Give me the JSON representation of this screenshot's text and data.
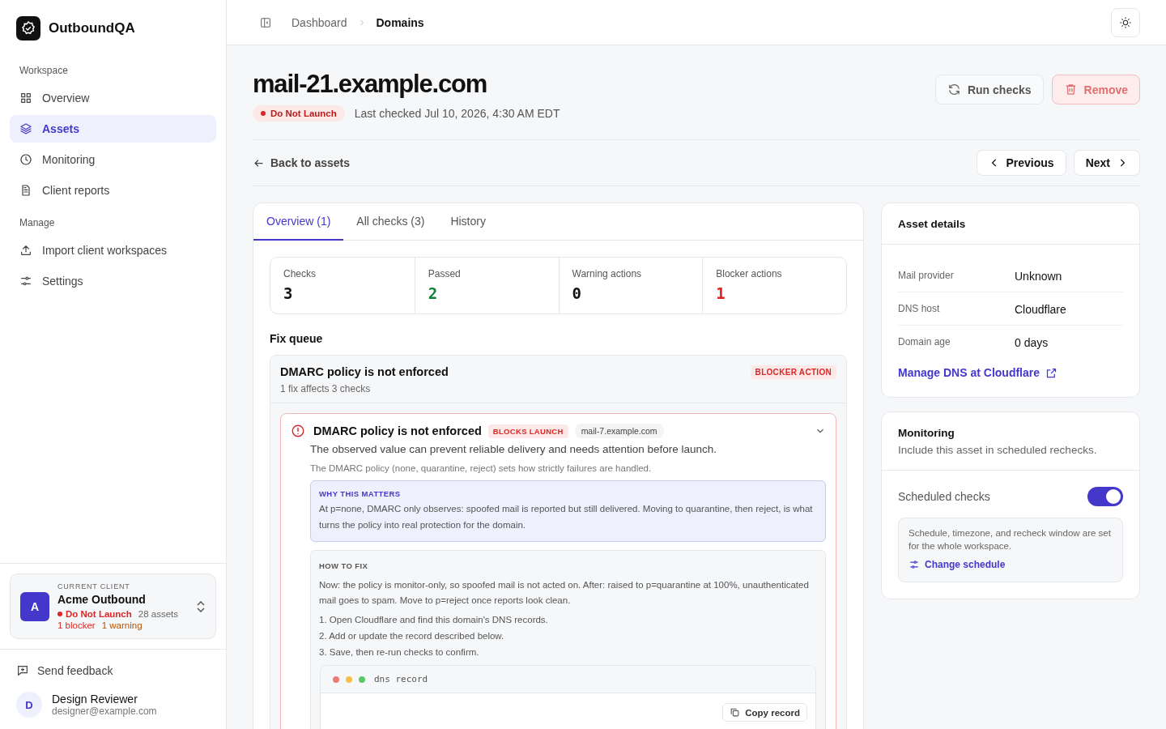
{
  "app": {
    "name": "OutboundQA"
  },
  "sidebar": {
    "sections": [
      {
        "title": "Workspace",
        "items": [
          {
            "label": "Overview",
            "selected": false
          },
          {
            "label": "Assets",
            "selected": true
          },
          {
            "label": "Monitoring",
            "selected": false
          },
          {
            "label": "Client reports",
            "selected": false
          }
        ]
      },
      {
        "title": "Manage",
        "items": [
          {
            "label": "Import client workspaces",
            "selected": false
          },
          {
            "label": "Settings",
            "selected": false
          }
        ]
      }
    ],
    "client": {
      "caption": "CURRENT CLIENT",
      "initial": "A",
      "name": "Acme Outbound",
      "status": "Do Not Launch",
      "assets": "28 assets",
      "blockers": "1 blocker",
      "warnings": "1 warning"
    },
    "feedback": "Send feedback",
    "user": {
      "initial": "D",
      "name": "Design Reviewer",
      "email": "designer@example.com"
    }
  },
  "breadcrumb": [
    "Dashboard",
    "Domains"
  ],
  "header": {
    "title": "mail-21.example.com",
    "status": "Do Not Launch",
    "last_checked": "Last checked Jul 10, 2026, 4:30 AM EDT",
    "run_button": "Run checks",
    "remove_button": "Remove"
  },
  "nav": {
    "back": "Back to assets",
    "previous": "Previous",
    "next": "Next"
  },
  "tabs": [
    {
      "label": "Overview (1)",
      "selected": true
    },
    {
      "label": "All checks (3)",
      "selected": false
    },
    {
      "label": "History",
      "selected": false
    }
  ],
  "stats": [
    {
      "label": "Checks",
      "value": "3",
      "color": "#111111"
    },
    {
      "label": "Passed",
      "value": "2",
      "color": "#15803d"
    },
    {
      "label": "Warning actions",
      "value": "0",
      "color": "#111111"
    },
    {
      "label": "Blocker actions",
      "value": "1",
      "color": "#dc2626"
    }
  ],
  "fix_queue": {
    "title": "Fix queue",
    "group": {
      "title": "DMARC policy is not enforced",
      "subtitle": "1 fix affects 3 checks",
      "badge": "BLOCKER ACTION",
      "issue": {
        "title": "DMARC policy is not enforced",
        "badge": "BLOCKS LAUNCH",
        "domain": "mail-7.example.com",
        "expanded": true,
        "summary": "The observed value can prevent reliable delivery and needs attention before launch.",
        "detail": "The DMARC policy (none, quarantine, reject) sets how strictly failures are handled.",
        "why": {
          "heading": "WHY THIS MATTERS",
          "text": "At p=none, DMARC only observes: spoofed mail is reported but still delivered. Moving to quarantine, then reject, is what turns the policy into real protection for the domain."
        },
        "how": {
          "heading": "HOW TO FIX",
          "text": "Now: the policy is monitor-only, so spoofed mail is not acted on. After: raised to p=quarantine at 100%, unauthenticated mail goes to spam. Move to p=reject once reports look clean.",
          "steps": [
            "1. Open Cloudflare and find this domain's DNS records.",
            "2. Add or update the record described below.",
            "3. Save, then re-run checks to confirm."
          ]
        },
        "code": {
          "title": "dns record",
          "button": "Copy record"
        }
      }
    }
  },
  "asset_details": {
    "title": "Asset details",
    "rows": [
      {
        "label": "Mail provider",
        "value": "Unknown"
      },
      {
        "label": "DNS host",
        "value": "Cloudflare"
      },
      {
        "label": "Domain age",
        "value": "0 days"
      }
    ],
    "link": "Manage DNS at Cloudflare"
  },
  "monitoring": {
    "title": "Monitoring",
    "subtitle": "Include this asset in scheduled rechecks.",
    "toggle": {
      "label": "Scheduled checks",
      "on": true
    },
    "note": {
      "text": "Schedule, timezone, and recheck window are set for the whole workspace.",
      "link": "Change schedule"
    }
  }
}
